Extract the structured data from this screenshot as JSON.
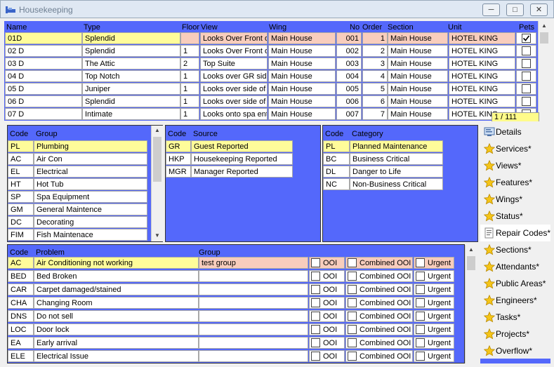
{
  "window": {
    "title": "Housekeeping"
  },
  "rooms": {
    "headers": {
      "name": "Name",
      "type": "Type",
      "floor": "Floor",
      "view": "View",
      "wing": "Wing",
      "no": "No",
      "order": "Order",
      "section": "Section",
      "unit": "Unit",
      "pets": "Pets"
    },
    "rows": [
      {
        "name": "01D",
        "type": "Splendid",
        "floor": "",
        "view": "Looks Over Front of",
        "wing": "Main House",
        "no": "001",
        "order": "1",
        "section": "Main House",
        "unit": "HOTEL KING",
        "pets": true
      },
      {
        "name": "02 D",
        "type": "Splendid",
        "floor": "1",
        "view": "Looks Over Front of",
        "wing": "Main House",
        "no": "002",
        "order": "2",
        "section": "Main House",
        "unit": "HOTEL KING",
        "pets": false
      },
      {
        "name": "03 D",
        "type": "The Attic",
        "floor": "2",
        "view": "Top Suite",
        "wing": "Main House",
        "no": "003",
        "order": "3",
        "section": "Main House",
        "unit": "HOTEL KING",
        "pets": false
      },
      {
        "name": "04 D",
        "type": "Top Notch",
        "floor": "1",
        "view": "Looks over GR side",
        "wing": "Main House",
        "no": "004",
        "order": "4",
        "section": "Main House",
        "unit": "HOTEL KING",
        "pets": false
      },
      {
        "name": "05 D",
        "type": "Juniper",
        "floor": "1",
        "view": "Looks over side of h",
        "wing": "Main House",
        "no": "005",
        "order": "5",
        "section": "Main House",
        "unit": "HOTEL KING",
        "pets": false
      },
      {
        "name": "06 D",
        "type": "Splendid",
        "floor": "1",
        "view": "Looks over side of h",
        "wing": "Main House",
        "no": "006",
        "order": "6",
        "section": "Main House",
        "unit": "HOTEL KING",
        "pets": false
      },
      {
        "name": "07 D",
        "type": "Intimate",
        "floor": "1",
        "view": "Looks onto spa entr",
        "wing": "Main House",
        "no": "007",
        "order": "7",
        "section": "Main House",
        "unit": "HOTEL KING",
        "pets": false
      }
    ],
    "counter": "1 / 111"
  },
  "groups": {
    "headers": {
      "code": "Code",
      "group": "Group"
    },
    "rows": [
      {
        "code": "PL",
        "group": "Plumbing"
      },
      {
        "code": "AC",
        "group": "Air Con"
      },
      {
        "code": "EL",
        "group": "Electrical"
      },
      {
        "code": "HT",
        "group": "Hot Tub"
      },
      {
        "code": "SP",
        "group": "Spa Equipment"
      },
      {
        "code": "GM",
        "group": "General Maintence"
      },
      {
        "code": "DC",
        "group": "Decorating"
      },
      {
        "code": "FIM",
        "group": "Fish Maintenace"
      }
    ]
  },
  "sources": {
    "headers": {
      "code": "Code",
      "source": "Source"
    },
    "rows": [
      {
        "code": "GR",
        "source": "Guest Reported"
      },
      {
        "code": "HKP",
        "source": "Housekeeping Reported"
      },
      {
        "code": "MGR",
        "source": "Manager Reported"
      }
    ]
  },
  "categories": {
    "headers": {
      "code": "Code",
      "category": "Category"
    },
    "rows": [
      {
        "code": "PL",
        "category": "Planned Maintenance"
      },
      {
        "code": "BC",
        "category": "Business Critical"
      },
      {
        "code": "DL",
        "category": "Danger to Life"
      },
      {
        "code": "NC",
        "category": "Non-Business Critical"
      }
    ]
  },
  "problems": {
    "headers": {
      "code": "Code",
      "problem": "Problem",
      "group": "Group"
    },
    "flag_labels": {
      "ooi": "OOI",
      "combined": "Combined OOI",
      "urgent": "Urgent"
    },
    "rows": [
      {
        "code": "AC",
        "problem": "Air Conditioning not working",
        "group": "test group"
      },
      {
        "code": "BED",
        "problem": "Bed Broken",
        "group": ""
      },
      {
        "code": "CAR",
        "problem": "Carpet damaged/stained",
        "group": ""
      },
      {
        "code": "CHA",
        "problem": "Changing Room",
        "group": ""
      },
      {
        "code": "DNS",
        "problem": "Do not sell",
        "group": ""
      },
      {
        "code": "LOC",
        "problem": "Door lock",
        "group": ""
      },
      {
        "code": "EA",
        "problem": "Early arrival",
        "group": ""
      },
      {
        "code": "ELE",
        "problem": "Electrical Issue",
        "group": ""
      }
    ]
  },
  "nav": [
    {
      "label": "Details",
      "icon": "details-icon"
    },
    {
      "label": "Services*",
      "icon": "star-icon"
    },
    {
      "label": "Views*",
      "icon": "star-icon"
    },
    {
      "label": "Features*",
      "icon": "star-icon"
    },
    {
      "label": "Wings*",
      "icon": "star-icon"
    },
    {
      "label": "Status*",
      "icon": "star-icon"
    },
    {
      "label": "Repair Codes*",
      "icon": "repair-codes-icon"
    },
    {
      "label": "Sections*",
      "icon": "star-icon"
    },
    {
      "label": "Attendants*",
      "icon": "star-icon"
    },
    {
      "label": "Public Areas*",
      "icon": "star-icon"
    },
    {
      "label": "Engineers*",
      "icon": "star-icon"
    },
    {
      "label": "Tasks*",
      "icon": "star-icon"
    },
    {
      "label": "Projects*",
      "icon": "star-icon"
    },
    {
      "label": "Overflow*",
      "icon": "star-icon"
    }
  ],
  "colors": {
    "panel": "#5468fb",
    "selected": "#fffc9a",
    "highlight": "#f8cdbd"
  }
}
